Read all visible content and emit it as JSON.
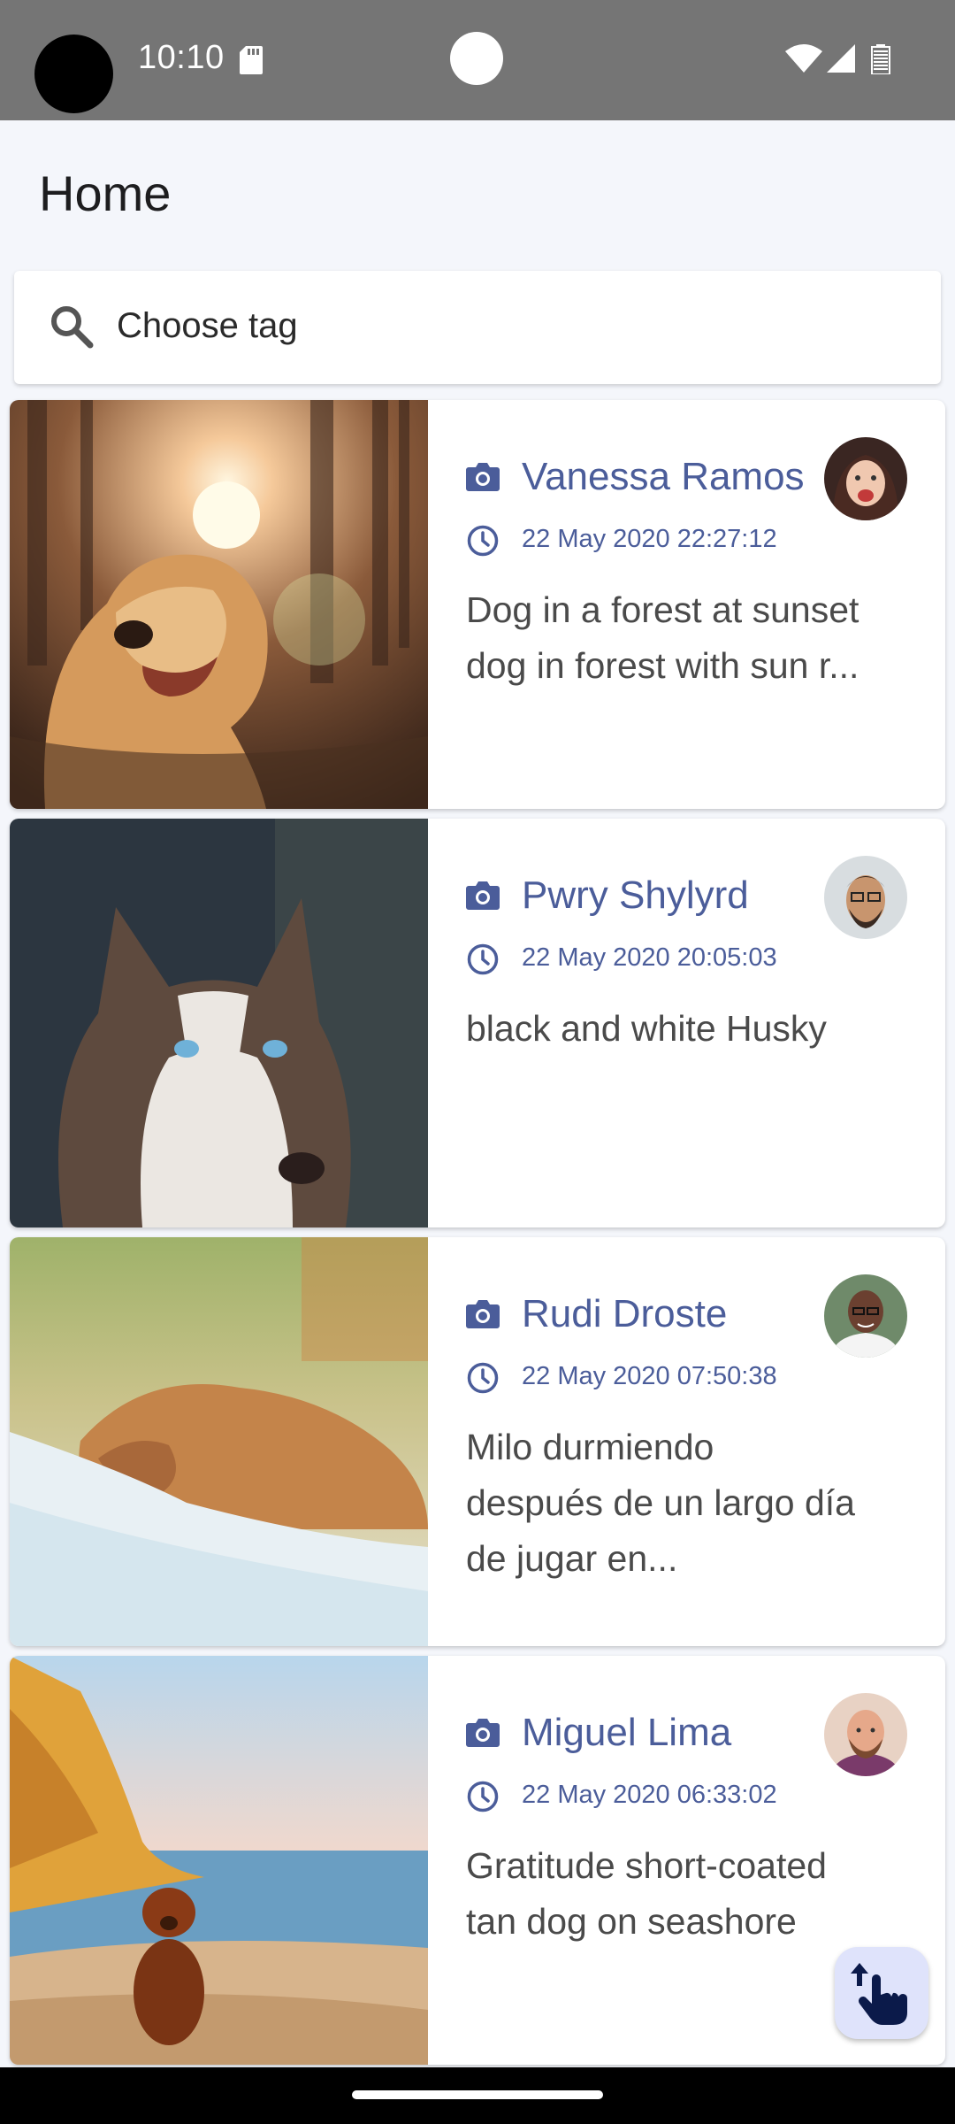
{
  "status_bar": {
    "time": "10:10",
    "icons": [
      "sd-card-icon",
      "wifi-icon",
      "signal-icon",
      "battery-icon"
    ]
  },
  "app_bar": {
    "title": "Home"
  },
  "search": {
    "placeholder": "Choose tag",
    "icon": "search-icon"
  },
  "posts": [
    {
      "author": "Vanessa Ramos",
      "date": "22 May 2020 22:27:12",
      "description_lines": [
        "Dog in a forest at sunset",
        "dog in forest with sun r..."
      ]
    },
    {
      "author": "Pwry Shylyrd",
      "date": "22 May 2020 20:05:03",
      "description_lines": [
        "black and white Husky"
      ]
    },
    {
      "author": "Rudi Droste",
      "date": "22 May 2020 07:50:38",
      "description_lines": [
        "Milo durmiendo",
        "después de un largo día",
        "de jugar en..."
      ]
    },
    {
      "author": "Miguel Lima",
      "date": "22 May 2020 06:33:02",
      "description_lines": [
        "Gratitude short-coated",
        "tan dog on seashore"
      ]
    }
  ],
  "colors": {
    "accent": "#4b5d9a",
    "status_bar": "#757575",
    "background": "#f4f6fb",
    "fab": "#dfe3fb"
  },
  "fab": {
    "icon": "touch-gesture-icon"
  }
}
